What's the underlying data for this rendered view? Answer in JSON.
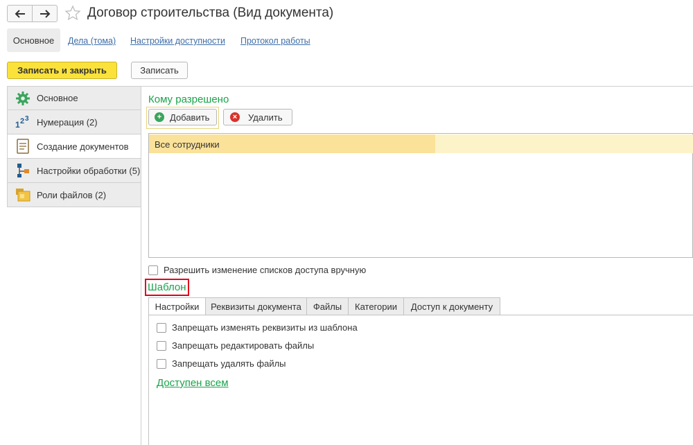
{
  "window": {
    "title": "Договор строительства (Вид документа)",
    "back_icon": "arrow-left-icon",
    "forward_icon": "arrow-right-icon",
    "favorite_icon": "star-icon"
  },
  "top_tabs": {
    "active": "Основное",
    "links": [
      "Дела (тома)",
      "Настройки доступности",
      "Протокол работы"
    ]
  },
  "toolbar": {
    "save_close_label": "Записать и закрыть",
    "save_label": "Записать"
  },
  "sidebar": {
    "items": [
      {
        "label": "Основное",
        "icon": "gear-icon"
      },
      {
        "label": "Нумерация (2)",
        "icon": "numbering-icon"
      },
      {
        "label": "Создание документов",
        "icon": "document-icon"
      },
      {
        "label": "Настройки обработки (5)",
        "icon": "process-icon"
      },
      {
        "label": "Роли файлов (2)",
        "icon": "folder-icon"
      }
    ],
    "active_index": 2
  },
  "access": {
    "title": "Кому разрешено",
    "add_label": "Добавить",
    "delete_label": "Удалить",
    "rows": [
      "Все сотрудники"
    ],
    "manual_checkbox_label": "Разрешить изменение списков доступа вручную"
  },
  "template": {
    "title": "Шаблон",
    "tabs": [
      "Настройки",
      "Реквизиты документа",
      "Файлы",
      "Категории",
      "Доступ к документу"
    ],
    "active_tab": 0,
    "options": [
      "Запрещать изменять реквизиты из шаблона",
      "Запрещать редактировать файлы",
      "Запрещать удалять файлы"
    ],
    "available_link": "Доступен всем"
  },
  "colors": {
    "accent_green": "#19a34a",
    "primary_yellow": "#fbe23a",
    "highlight_red": "#e3001b",
    "link_blue": "#3e6ea8"
  }
}
